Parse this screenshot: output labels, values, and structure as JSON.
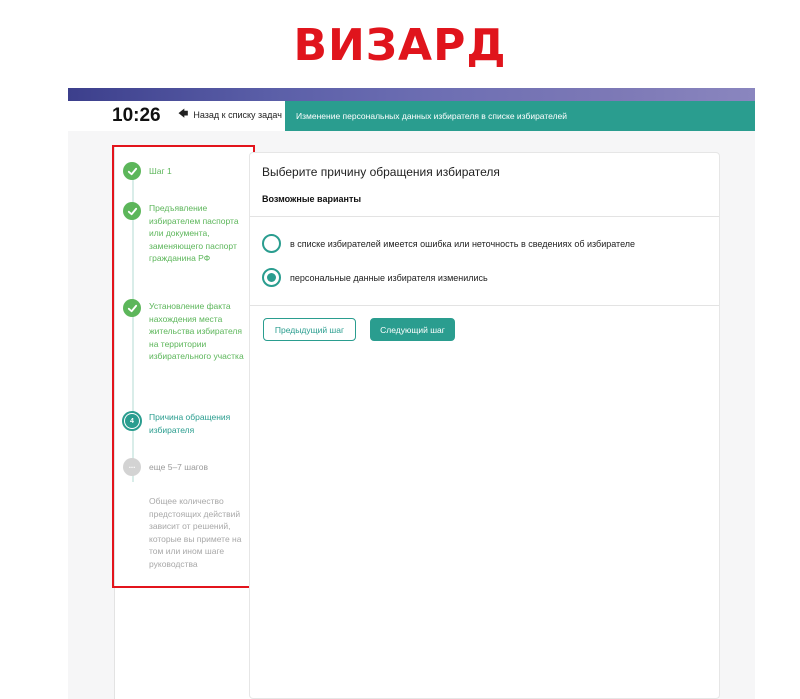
{
  "caption": "ВИЗАРД",
  "header": {
    "clock": "10:26",
    "back_label": "Назад к списку задач",
    "task_title": "Изменение персональных данных избирателя в списке избирателей"
  },
  "steps": [
    {
      "status": "done",
      "label": "Шаг 1"
    },
    {
      "status": "done",
      "label": "Предъявление избирателем паспорта или документа, заменяющего паспорт гражданина РФ"
    },
    {
      "status": "done",
      "label": "Установление факта нахождения места жительства избирателя на территории избирательного участка"
    },
    {
      "status": "current",
      "number": "4",
      "label": "Причина обращения избирателя"
    },
    {
      "status": "more",
      "icon_text": "···",
      "label": "еще 5–7 шагов"
    }
  ],
  "steps_note": "Общее количество предстоящих действий зависит от решений, которые вы примете на том или ином шаге руководства",
  "main": {
    "title": "Выберите причину обращения избирателя",
    "subtitle": "Возможные варианты",
    "options": [
      {
        "label": "в списке избирателей имеется ошибка или неточность в сведениях об избирателе",
        "checked": false
      },
      {
        "label": "персональные данные избирателя изменились",
        "checked": true
      }
    ],
    "prev_button": "Предыдущий шаг",
    "next_button": "Следующий шаг"
  },
  "colors": {
    "accent": "#2a9d8f",
    "done": "#5cb65a",
    "highlight_frame": "#e3141c",
    "caption": "#e0141c"
  }
}
